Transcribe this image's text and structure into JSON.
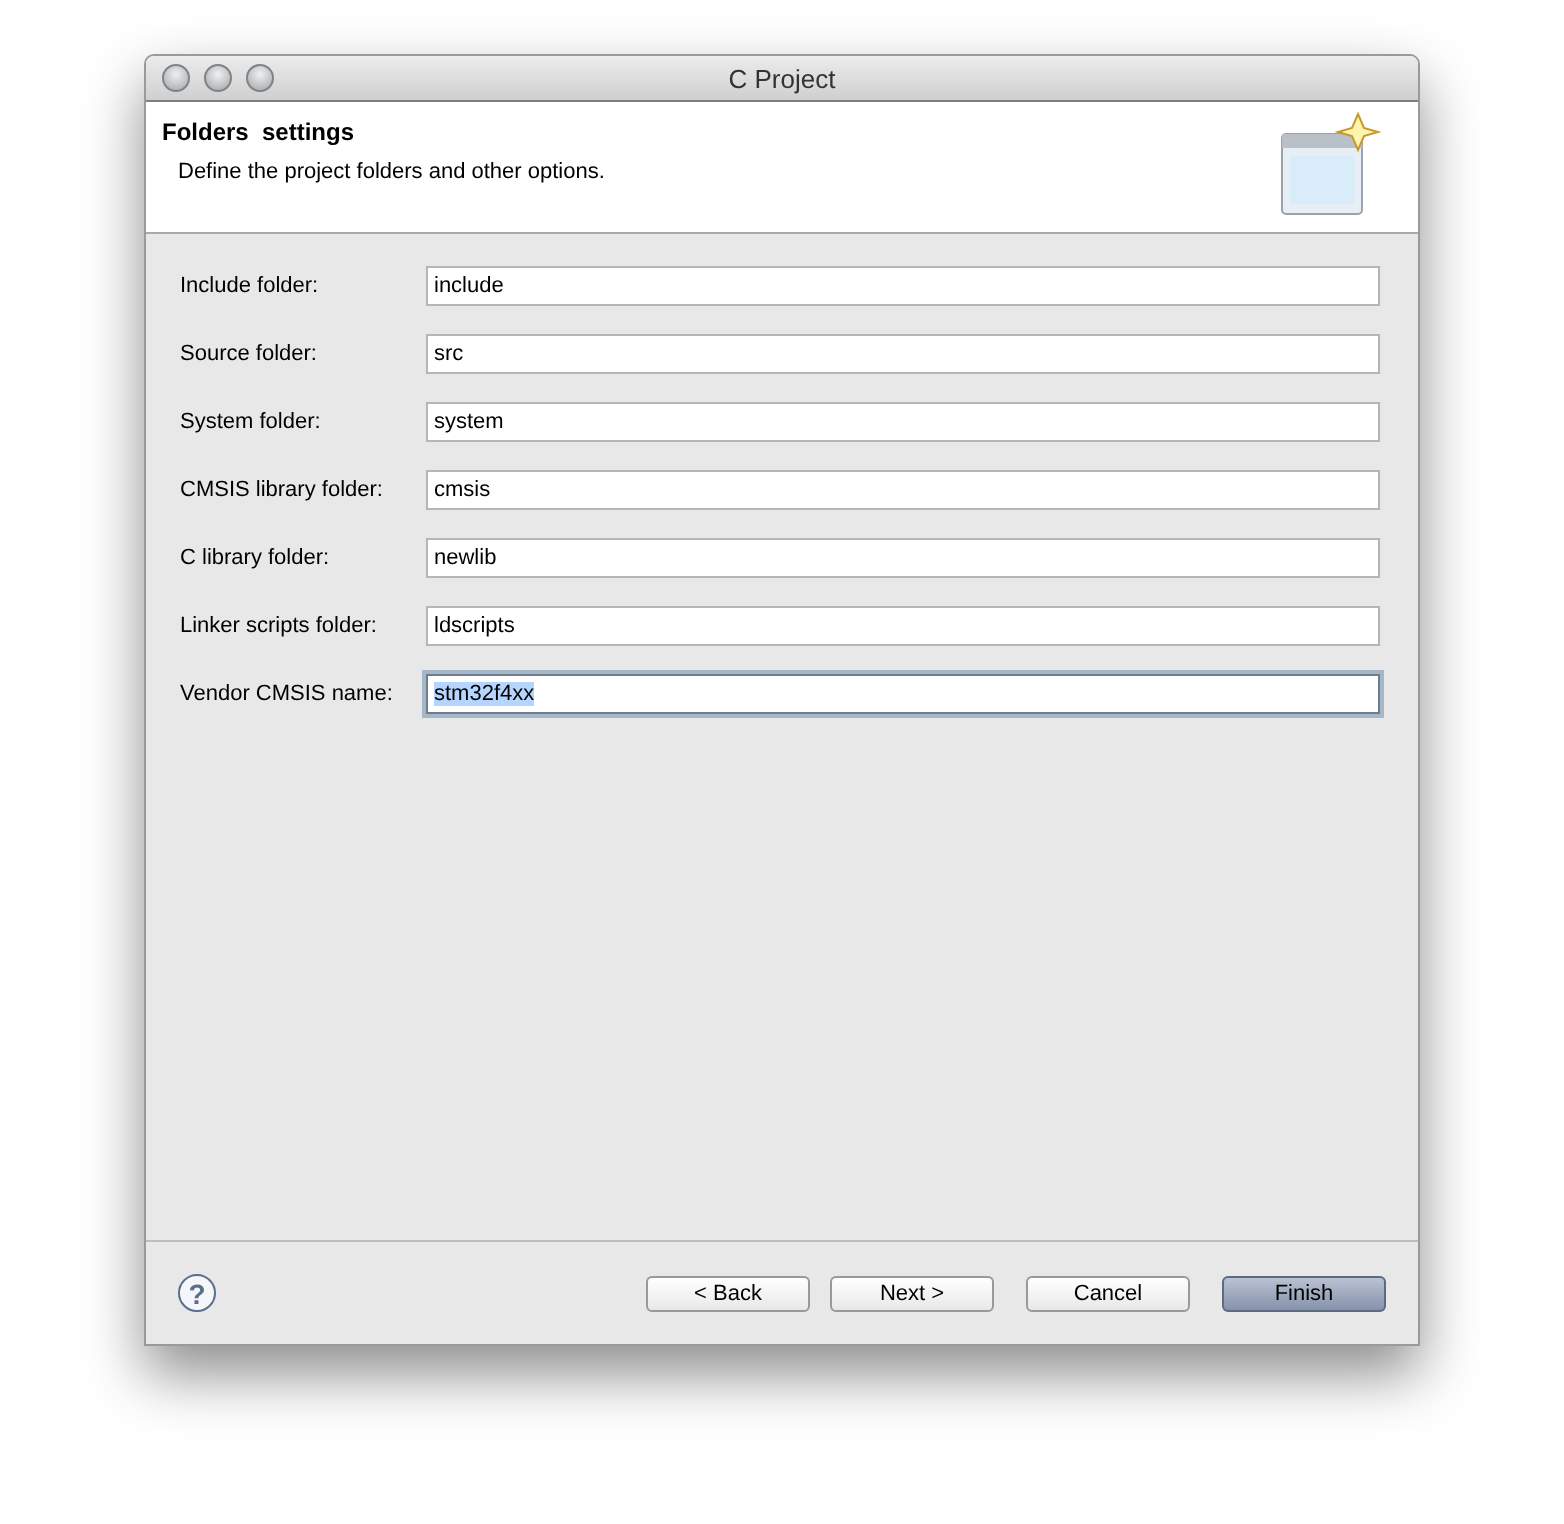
{
  "window": {
    "title": "C Project"
  },
  "header": {
    "title": "Folders  settings",
    "description": "Define the project folders and other options."
  },
  "fields": [
    {
      "label": "Include folder:",
      "value": "include",
      "focused": false
    },
    {
      "label": "Source folder:",
      "value": "src",
      "focused": false
    },
    {
      "label": "System folder:",
      "value": "system",
      "focused": false
    },
    {
      "label": "CMSIS library folder:",
      "value": "cmsis",
      "focused": false
    },
    {
      "label": "C library folder:",
      "value": "newlib",
      "focused": false
    },
    {
      "label": "Linker scripts folder:",
      "value": "ldscripts",
      "focused": false
    },
    {
      "label": "Vendor CMSIS name:",
      "value": "stm32f4xx",
      "focused": true
    }
  ],
  "help": "?",
  "buttons": [
    {
      "label": "< Back",
      "default": false
    },
    {
      "label": "Next >",
      "default": false
    },
    {
      "label": "Cancel",
      "default": false
    },
    {
      "label": "Finish",
      "default": true
    }
  ]
}
